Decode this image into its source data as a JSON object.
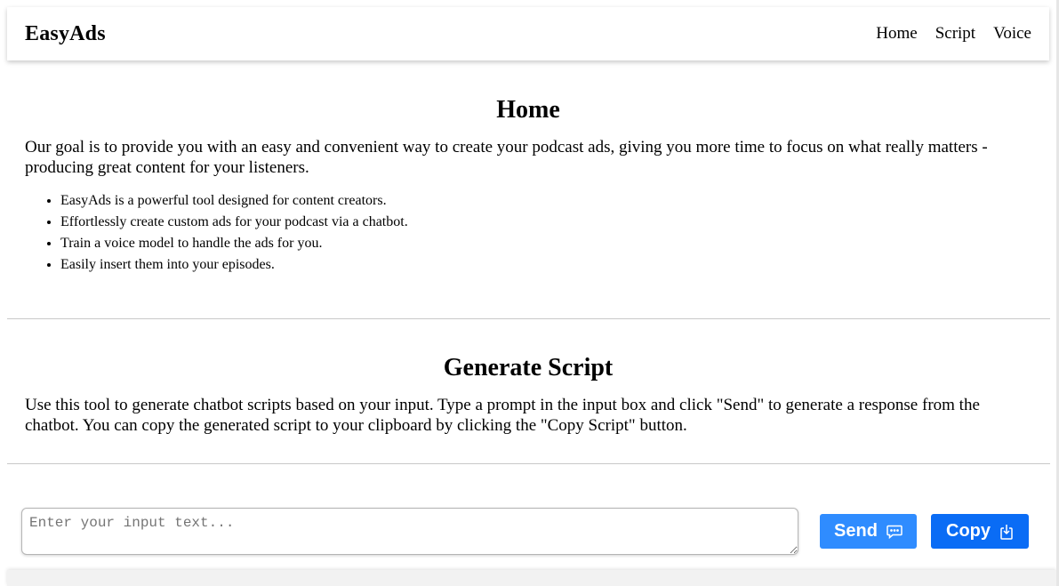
{
  "navbar": {
    "brand": "EasyAds",
    "links": [
      "Home",
      "Script",
      "Voice"
    ]
  },
  "home": {
    "title": "Home",
    "intro": "Our goal is to provide you with an easy and convenient way to create your podcast ads, giving you more time to focus on what really matters - producing great content for your listeners.",
    "features": [
      "EasyAds is a powerful tool designed for content creators.",
      "Effortlessly create custom ads for your podcast via a chatbot.",
      "Train a voice model to handle the ads for you.",
      "Easily insert them into your episodes."
    ]
  },
  "script": {
    "title": "Generate Script",
    "description": "Use this tool to generate chatbot scripts based on your input. Type a prompt in the input box and click \"Send\" to generate a response from the chatbot. You can copy the generated script to your clipboard by clicking the \"Copy Script\" button.",
    "input_value": "",
    "input_placeholder": "Enter your input text...",
    "send_label": "Send",
    "send_icon": "chat-bubble-icon",
    "copy_label": "Copy",
    "copy_icon": "clipboard-download-icon"
  },
  "colors": {
    "send_button": "#2f8cff",
    "copy_button": "#0a6cf5"
  }
}
